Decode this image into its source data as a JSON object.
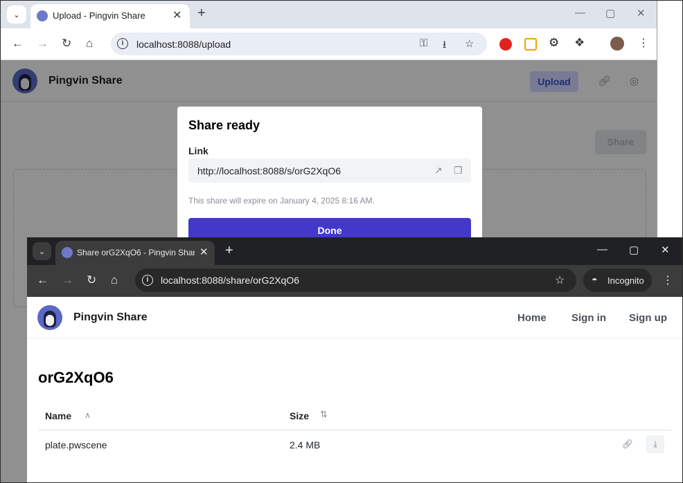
{
  "back_window": {
    "tab_title": "Upload - Pingvin Share",
    "url": "localhost:8088/upload",
    "page": {
      "brand": "Pingvin Share",
      "upload_button": "Upload",
      "share_button": "Share"
    },
    "modal": {
      "title": "Share ready",
      "link_label": "Link",
      "link_value": "http://localhost:8088/s/orG2XqO6",
      "expire_text": "This share will expire on January 4, 2025 8:16 AM.",
      "done_button": "Done"
    }
  },
  "front_window": {
    "tab_title": "Share orG2XqO6 - Pingvin Share",
    "url": "localhost:8088/share/orG2XqO6",
    "incognito_label": "Incognito",
    "page": {
      "brand": "Pingvin Share",
      "nav": [
        "Home",
        "Sign in",
        "Sign up"
      ],
      "share_title": "orG2XqO6",
      "table": {
        "columns": [
          "Name",
          "Size"
        ],
        "rows": [
          {
            "name": "plate.pwscene",
            "size": "2.4 MB"
          }
        ]
      }
    }
  },
  "colors": {
    "primary": "#4338ca",
    "brand_logo": "#5b68c4",
    "upload_btn_bg": "#d0d4ff",
    "incognito_chrome": "#202124"
  },
  "icons": {
    "link_actions": [
      "external-link-icon",
      "copy-icon"
    ],
    "row_actions": [
      "link-icon",
      "download-icon"
    ]
  }
}
